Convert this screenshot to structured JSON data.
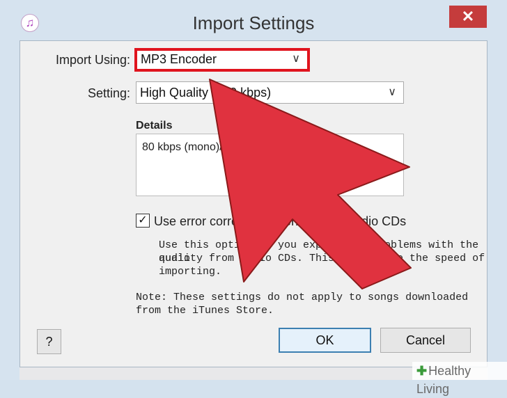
{
  "window": {
    "title": "Import Settings",
    "close_label": "✕",
    "app_icon_glyph": "♫"
  },
  "form": {
    "import_using_label": "Import Using:",
    "import_using_value": "MP3 Encoder",
    "setting_label": "Setting:",
    "setting_value": "High Quality (160 kbps)",
    "dropdown_glyph": "∨"
  },
  "details": {
    "title": "Details",
    "text": "80 kbps (mono)/160 kbps (stereo)."
  },
  "error_correction": {
    "checked": true,
    "check_glyph": "✓",
    "label": "Use error correction when reading Audio CDs",
    "help_lines": [
      "Use this option if you experience problems with the audio",
      "quality from Audio CDs. This may reduce the speed of",
      "importing."
    ]
  },
  "note_lines": [
    "Note: These settings do not apply to songs downloaded",
    "from the iTunes Store."
  ],
  "buttons": {
    "help": "?",
    "ok": "OK",
    "cancel": "Cancel"
  },
  "overlay": {
    "arrow_color": "#e0323f"
  },
  "watermark": {
    "leaf": "✚",
    "text": "Healthy Living"
  }
}
